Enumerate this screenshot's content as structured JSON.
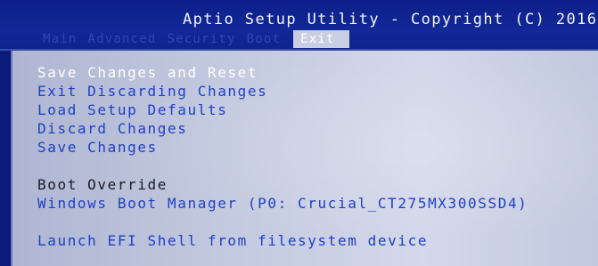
{
  "header": {
    "title": "Aptio Setup Utility - Copyright (C) 2016",
    "tabs": [
      {
        "label": "Main"
      },
      {
        "label": "Advanced"
      },
      {
        "label": "Security"
      },
      {
        "label": "Boot"
      },
      {
        "label": "Exit"
      }
    ],
    "active_tab": "Exit"
  },
  "exit_menu": {
    "items": [
      {
        "label": "Save Changes and Reset"
      },
      {
        "label": "Exit Discarding Changes"
      },
      {
        "label": "Load Setup Defaults"
      },
      {
        "label": "Discard Changes"
      },
      {
        "label": "Save Changes"
      }
    ],
    "boot_override_label": "Boot Override",
    "boot_override_items": [
      {
        "label": "Windows Boot Manager (P0: Crucial_CT275MX300SSD4)"
      }
    ],
    "efi_shell_label": "Launch EFI Shell from filesystem device"
  },
  "colors": {
    "background": "#0b1b7a",
    "panel": "#c5cbe0",
    "selected_text": "#ffffff",
    "link_text": "#1e3fc8",
    "label_text": "#1a1a2a"
  }
}
